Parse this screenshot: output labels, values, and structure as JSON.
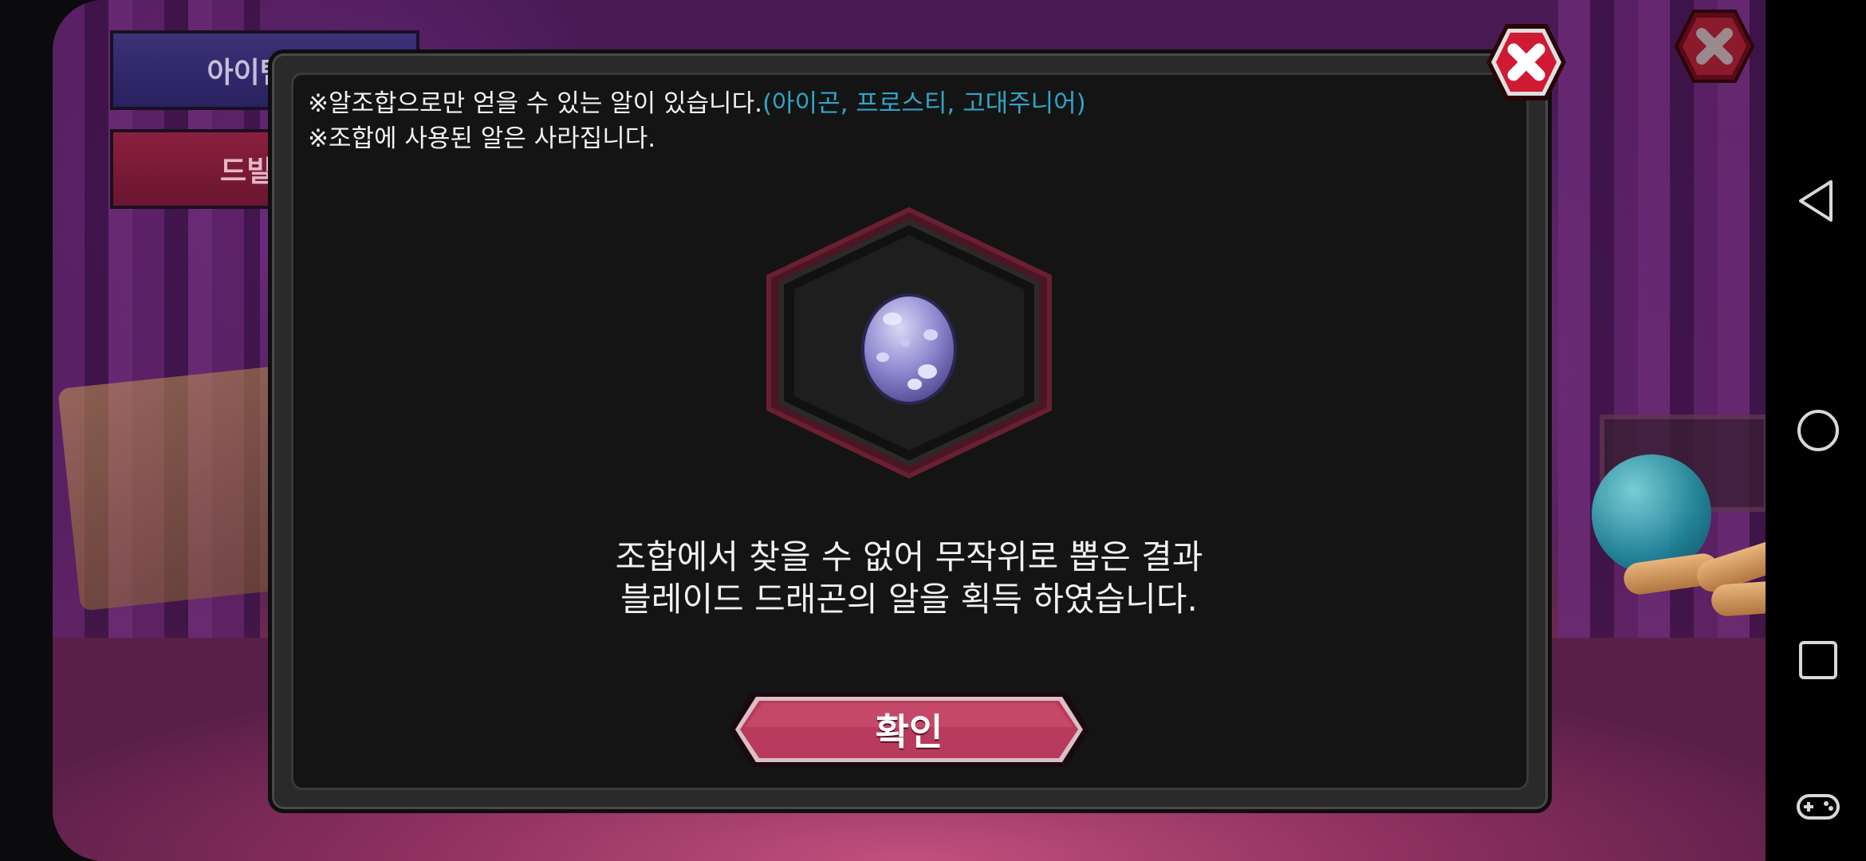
{
  "background": {
    "menu_buttons": [
      {
        "label": "아이템 코"
      },
      {
        "label": "드빌 가"
      }
    ]
  },
  "dialog": {
    "notice_line1_main": "※알조합으로만 얻을 수 있는 알이 있습니다.",
    "notice_line1_highlight": "(아이곤, 프로스티, 고대주니어)",
    "notice_line2": "※조합에 사용된 알은 사라집니다.",
    "result_line1": "조합에서 찾을 수 없어 무작위로 뽑은 결과",
    "result_line2": "블레이드 드래곤의 알을 획득 하였습니다.",
    "confirm_label": "확인"
  },
  "icons": {
    "egg": "purple-spotted-egg-icon",
    "close": "close-x-icon",
    "nav_back": "back-triangle-icon",
    "nav_home": "home-circle-icon",
    "nav_recents": "recents-square-icon",
    "nav_game": "gamepad-icon"
  },
  "colors": {
    "highlight_text": "#2fa5c9",
    "confirm_button": "#b83a5c",
    "close_button": "#c8102e"
  }
}
